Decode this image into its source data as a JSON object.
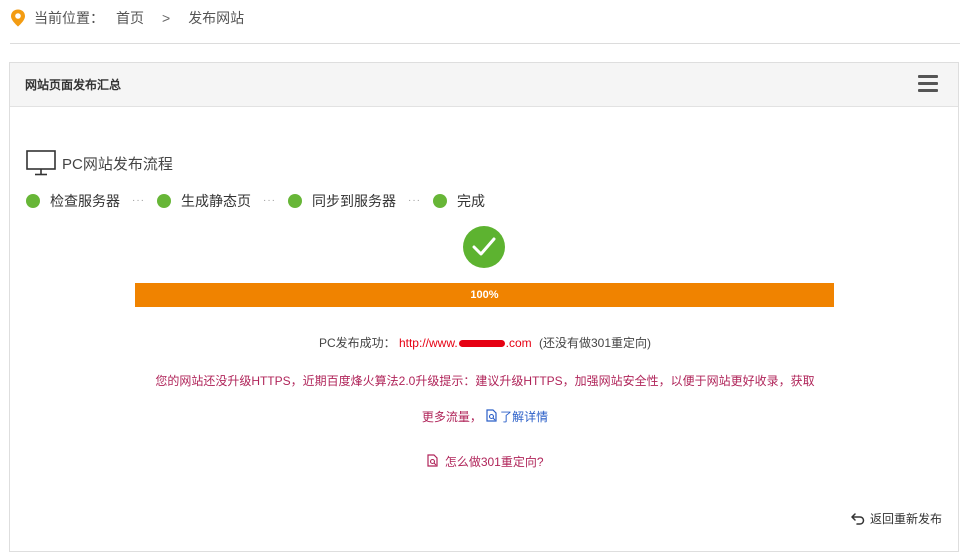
{
  "breadcrumb": {
    "label": "当前位置：",
    "home": "首页",
    "separator": ">",
    "current": "发布网站",
    "icon": "location-pin-icon",
    "icon_color": "#f39c12"
  },
  "panel": {
    "title": "网站页面发布汇总",
    "menu_icon": "hamburger-menu-icon"
  },
  "flow": {
    "title": "PC网站发布流程",
    "icon": "monitor-icon",
    "steps": [
      {
        "label": "检查服务器"
      },
      {
        "label": "生成静态页"
      },
      {
        "label": "同步到服务器"
      },
      {
        "label": "完成"
      }
    ],
    "separator": "···",
    "step_color": "#67b637"
  },
  "result": {
    "check_icon": "checkmark-circle-icon",
    "progress_percent": 100,
    "progress_label": "100%",
    "progress_color": "#f08300",
    "success_prefix": "PC发布成功：",
    "url_prefix": "http://www.",
    "url_suffix": ".com",
    "success_note": "(还没有做301重定向)",
    "https_warning": "您的网站还没升级HTTPS，近期百度烽火算法2.0升级提示：建议升级HTTPS，加强网站安全性，以便于网站更好收录，获取更多流量，",
    "learn_more": "了解详情",
    "howto_301": "怎么做301重定向?",
    "republish": "返回重新发布"
  }
}
